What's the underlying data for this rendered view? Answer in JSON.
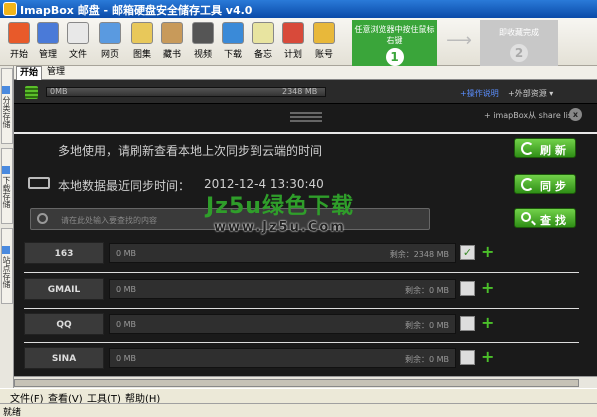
{
  "window": {
    "title": "ImapBox 邮盘 - 邮箱硬盘安全储存工具 v4.0"
  },
  "toolbar": {
    "items": [
      {
        "label": "开始",
        "icon": "start-icon",
        "color": "#e85a2a"
      },
      {
        "label": "管理",
        "icon": "manage-icon",
        "color": "#4a7ad8"
      },
      {
        "label": "文件",
        "icon": "file-icon",
        "color": "#e8e8e8"
      },
      {
        "label": "网页",
        "icon": "webpage-icon",
        "color": "#5a9ae0"
      },
      {
        "label": "图集",
        "icon": "album-icon",
        "color": "#e8c85a"
      },
      {
        "label": "藏书",
        "icon": "books-icon",
        "color": "#c89a5a"
      },
      {
        "label": "视频",
        "icon": "video-icon",
        "color": "#555555"
      },
      {
        "label": "下载",
        "icon": "download-icon",
        "color": "#3a8ad8"
      },
      {
        "label": "备忘",
        "icon": "memo-icon",
        "color": "#e8e4a0"
      },
      {
        "label": "计划",
        "icon": "calendar-icon",
        "color": "#d84a3a"
      },
      {
        "label": "账号",
        "icon": "lock-icon",
        "color": "#e8b83a"
      }
    ]
  },
  "banner": {
    "step1_text": "任意浏览器中按住鼠标右键",
    "step1_num": "1",
    "step2_text": "即收藏完成",
    "step2_num": "2",
    "arrow": "⟶"
  },
  "sidebar": {
    "tabs": [
      "分类存储",
      "下载存储",
      "站点存储"
    ]
  },
  "tabs": [
    "开始",
    "管理"
  ],
  "capacity": {
    "used": "0MB",
    "total": "2348 MB",
    "link1": "+操作说明",
    "link2": "+外部资源 ▾"
  },
  "promo": {
    "text": "+ imapBox从 share list",
    "close": "x"
  },
  "sync": {
    "hint_text": "多地使用，请刷新查看本地上次同步到云端的时间",
    "refresh_label": "刷新",
    "last_sync_label": "本地数据最近同步时间：",
    "last_sync_time": "2012-12-4 13:30:40",
    "sync_label": "同步"
  },
  "search": {
    "placeholder": "请在此处输入要查找的内容",
    "button_label": "查找"
  },
  "accounts": [
    {
      "name": "163",
      "used": "0 MB",
      "remain": "剩余：2348 MB",
      "checked": true
    },
    {
      "name": "GMAIL",
      "used": "0 MB",
      "remain": "剩余：0 MB",
      "checked": false
    },
    {
      "name": "QQ",
      "used": "0 MB",
      "remain": "剩余：0 MB",
      "checked": false
    },
    {
      "name": "SINA",
      "used": "0 MB",
      "remain": "剩余：0 MB",
      "checked": false
    }
  ],
  "watermark": {
    "main": "Jz5u绿色下载",
    "sub": "www.Jz5u.Com"
  },
  "menu": [
    "文件(F)",
    "查看(V)",
    "工具(T)",
    "帮助(H)"
  ],
  "status": "就绪"
}
